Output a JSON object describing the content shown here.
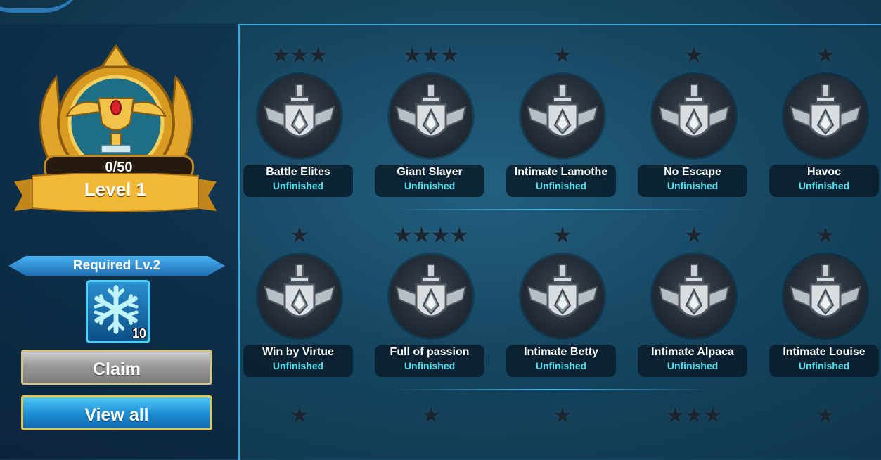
{
  "trophy": {
    "progress_text": "0/50",
    "level_text": "Level 1"
  },
  "reward": {
    "required_text": "Required Lv.2",
    "icon": "snowflake-icon",
    "count": "10"
  },
  "buttons": {
    "claim_label": "Claim",
    "view_all_label": "View all"
  },
  "achievements": [
    {
      "name": "Battle Elites",
      "status": "Unfinished",
      "stars": 3
    },
    {
      "name": "Giant Slayer",
      "status": "Unfinished",
      "stars": 3
    },
    {
      "name": "Intimate Lamothe",
      "status": "Unfinished",
      "stars": 1
    },
    {
      "name": "No Escape",
      "status": "Unfinished",
      "stars": 1
    },
    {
      "name": "Havoc",
      "status": "Unfinished",
      "stars": 1
    },
    {
      "name": "Win by Virtue",
      "status": "Unfinished",
      "stars": 1
    },
    {
      "name": "Full of passion",
      "status": "Unfinished",
      "stars": 4
    },
    {
      "name": "Intimate Betty",
      "status": "Unfinished",
      "stars": 1
    },
    {
      "name": "Intimate Alpaca",
      "status": "Unfinished",
      "stars": 1
    },
    {
      "name": "Intimate Louise",
      "status": "Unfinished",
      "stars": 1
    }
  ],
  "partial_row_stars": [
    1,
    1,
    1,
    3,
    1
  ],
  "colors": {
    "status": "#4de3ee",
    "panel_border": "#3fa6d8",
    "gold": "#e8a72a"
  }
}
